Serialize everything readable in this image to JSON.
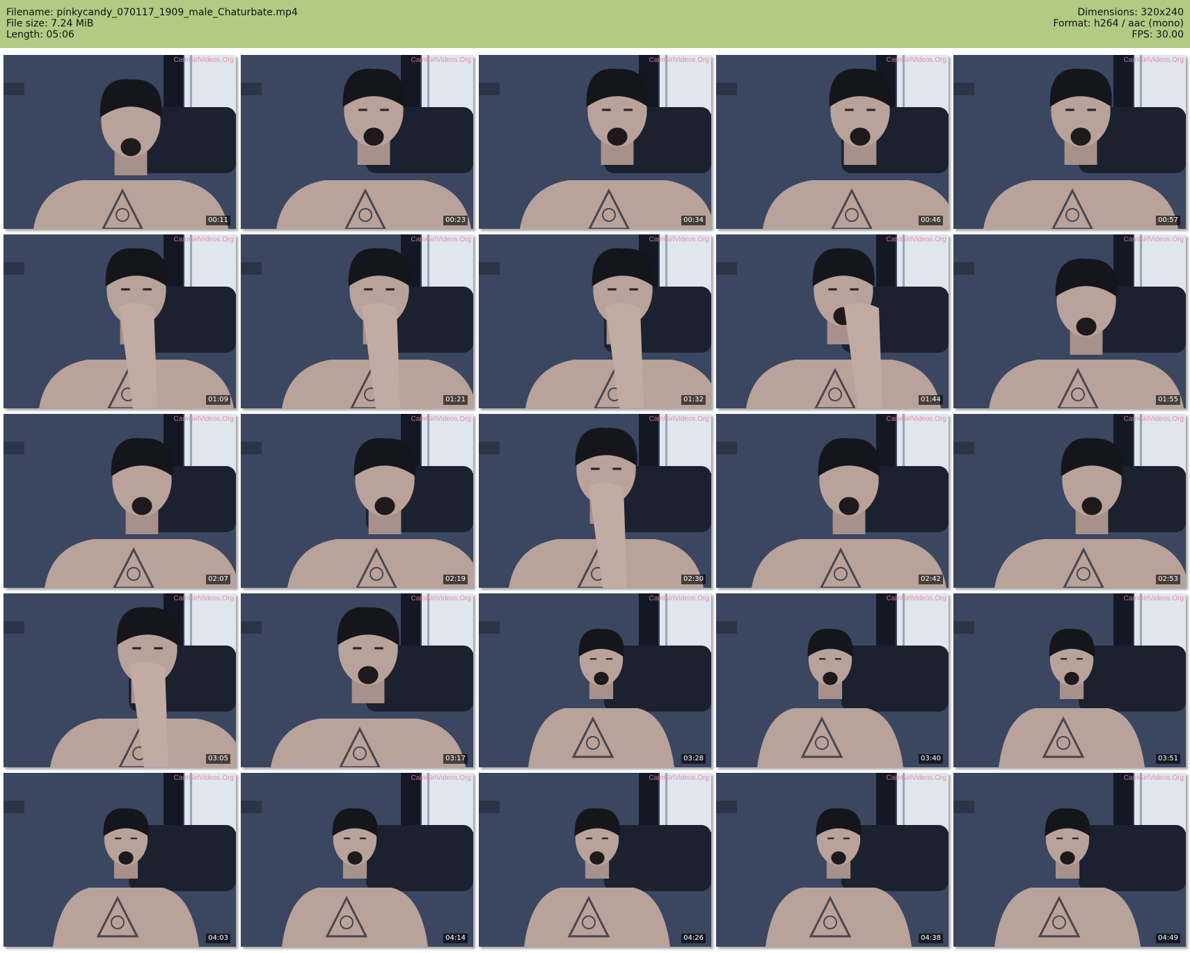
{
  "header": {
    "left": [
      {
        "label": "Filename:",
        "value": "pinkycandy_070117_1909_male_Chaturbate.mp4"
      },
      {
        "label": "File size:",
        "value": "7.24 MiB"
      },
      {
        "label": "Length:",
        "value": "05:06"
      }
    ],
    "right": [
      {
        "label": "Dimensions:",
        "value": "320x240"
      },
      {
        "label": "Format:",
        "value": "h264 / aac (mono)"
      },
      {
        "label": "FPS:",
        "value": "30.00"
      }
    ]
  },
  "watermark": "CamGirlVideos.Org",
  "colors": {
    "header_bg": "#b1cb84",
    "wall": "#3b4660",
    "sofa": "#1c2130",
    "skin": "#b8a29a",
    "hair": "#15151c"
  },
  "thumbnails": [
    {
      "timestamp": "00:11",
      "pose": "head-down"
    },
    {
      "timestamp": "00:23",
      "pose": "facing"
    },
    {
      "timestamp": "00:34",
      "pose": "facing"
    },
    {
      "timestamp": "00:46",
      "pose": "facing"
    },
    {
      "timestamp": "00:57",
      "pose": "facing"
    },
    {
      "timestamp": "01:09",
      "pose": "hand-on-face"
    },
    {
      "timestamp": "01:21",
      "pose": "hand-on-face"
    },
    {
      "timestamp": "01:32",
      "pose": "hand-on-face"
    },
    {
      "timestamp": "01:44",
      "pose": "hand-on-cheek"
    },
    {
      "timestamp": "01:55",
      "pose": "head-down"
    },
    {
      "timestamp": "02:07",
      "pose": "head-down"
    },
    {
      "timestamp": "02:19",
      "pose": "head-down"
    },
    {
      "timestamp": "02:30",
      "pose": "hand-on-face"
    },
    {
      "timestamp": "02:42",
      "pose": "head-down"
    },
    {
      "timestamp": "02:53",
      "pose": "head-down"
    },
    {
      "timestamp": "03:05",
      "pose": "hand-on-face"
    },
    {
      "timestamp": "03:17",
      "pose": "facing"
    },
    {
      "timestamp": "03:28",
      "pose": "far"
    },
    {
      "timestamp": "03:40",
      "pose": "far"
    },
    {
      "timestamp": "03:51",
      "pose": "far"
    },
    {
      "timestamp": "04:03",
      "pose": "far"
    },
    {
      "timestamp": "04:14",
      "pose": "far"
    },
    {
      "timestamp": "04:26",
      "pose": "far"
    },
    {
      "timestamp": "04:38",
      "pose": "far"
    },
    {
      "timestamp": "04:49",
      "pose": "far"
    }
  ]
}
